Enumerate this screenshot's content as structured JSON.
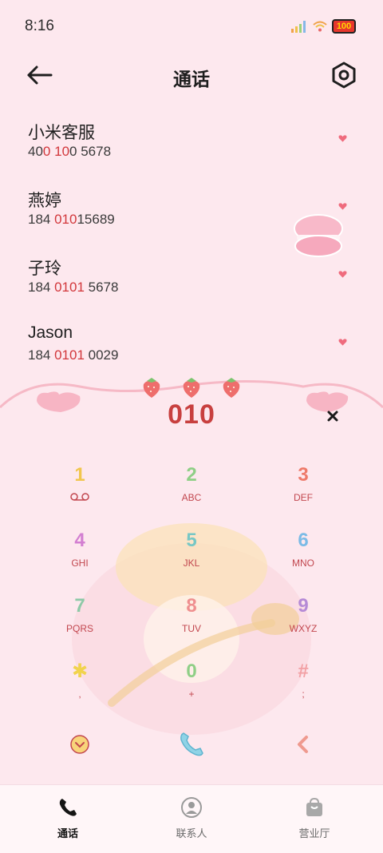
{
  "status_bar": {
    "time": "8:16",
    "battery": "100"
  },
  "header": {
    "title": "通话"
  },
  "contacts": [
    {
      "name": "小米客服",
      "number_parts": [
        "40",
        "0",
        " ",
        "10",
        "0 5678"
      ]
    },
    {
      "name": "燕婷",
      "number_parts": [
        "184 ",
        "010",
        "15689"
      ]
    },
    {
      "name": "子玲",
      "number_parts": [
        "184 ",
        "0101",
        " 5678"
      ]
    },
    {
      "name": "Jason",
      "number_parts": [
        "184 ",
        "0101",
        " 0029"
      ]
    }
  ],
  "dial_display": "010",
  "keypad": [
    {
      "digit": "1",
      "letters": "",
      "color": "#f1c64d"
    },
    {
      "digit": "2",
      "letters": "ABC",
      "color": "#8fcf86"
    },
    {
      "digit": "3",
      "letters": "DEF",
      "color": "#ee7a6a"
    },
    {
      "digit": "4",
      "letters": "GHI",
      "color": "#d37fd1"
    },
    {
      "digit": "5",
      "letters": "JKL",
      "color": "#77c7c5"
    },
    {
      "digit": "6",
      "letters": "MNO",
      "color": "#7bbbe6"
    },
    {
      "digit": "7",
      "letters": "PQRS",
      "color": "#8dc9a7"
    },
    {
      "digit": "8",
      "letters": "TUV",
      "color": "#ef8f8f"
    },
    {
      "digit": "9",
      "letters": "WXYZ",
      "color": "#b58ad6"
    },
    {
      "digit": "✱",
      "letters": ",",
      "color": "#f1d34d"
    },
    {
      "digit": "0",
      "letters": "+",
      "color": "#8fcf86"
    },
    {
      "digit": "#",
      "letters": ";",
      "color": "#f2a0a4"
    }
  ],
  "tabs": [
    {
      "label": "通话",
      "active": true
    },
    {
      "label": "联系人",
      "active": false
    },
    {
      "label": "营业厅",
      "active": false
    }
  ],
  "colors": {
    "accent": "#d2373b",
    "background": "#fde8ee",
    "label": "#c2474f"
  }
}
